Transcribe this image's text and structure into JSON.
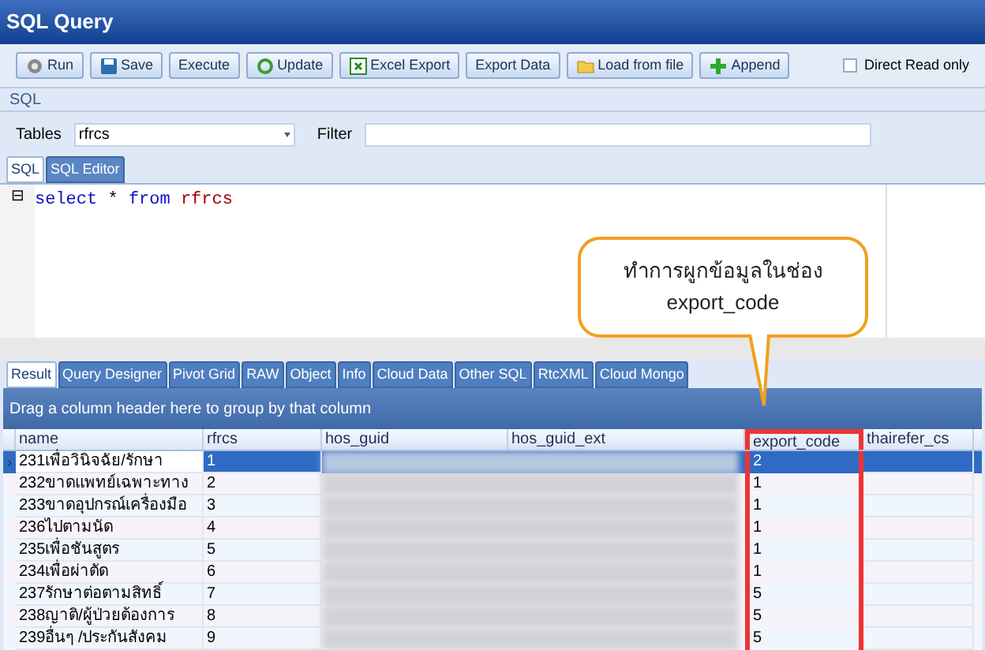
{
  "window": {
    "title": "SQL Query"
  },
  "toolbar": {
    "buttons": [
      "Run",
      "Save",
      "Execute",
      "Update",
      "Excel Export",
      "Export Data",
      "Load from file",
      "Append"
    ],
    "checkbox": {
      "label": "Direct Read only",
      "checked": false
    }
  },
  "section_label": "SQL",
  "tables": {
    "label": "Tables",
    "value": "rfrcs"
  },
  "filter": {
    "label": "Filter"
  },
  "editor_tabs": [
    {
      "label": "SQL",
      "selected": true
    },
    {
      "label": "SQL Editor",
      "selected": false
    }
  ],
  "editor": {
    "fold": "⊟",
    "keyword1": "select",
    "star": "*",
    "keyword2": "from",
    "table": "rfrcs"
  },
  "callout": {
    "line1": "ทำการผูกข้อมูลในช่อง",
    "line2": "export_code"
  },
  "result_tabs": [
    {
      "label": "Result",
      "selected": true
    },
    {
      "label": "Query Designer",
      "selected": false
    },
    {
      "label": "Pivot Grid",
      "selected": false
    },
    {
      "label": "RAW",
      "selected": false
    },
    {
      "label": "Object",
      "selected": false
    },
    {
      "label": "Info",
      "selected": false
    },
    {
      "label": "Cloud Data",
      "selected": false
    },
    {
      "label": "Other SQL",
      "selected": false
    },
    {
      "label": "RtcXML",
      "selected": false
    },
    {
      "label": "Cloud Mongo",
      "selected": false
    }
  ],
  "group_hint": "Drag a column header here to group by that column",
  "table": {
    "columns": [
      "name",
      "rfrcs",
      "hos_guid",
      "hos_guid_ext",
      "export_code",
      "thairefer_cs"
    ],
    "row_marker": "›",
    "rows": [
      {
        "name": "231เพื่อวินิจฉัย/รักษา",
        "rfrcs": "1",
        "export_code": "2",
        "selected": true
      },
      {
        "name": "232ขาดแพทย์เฉพาะทาง",
        "rfrcs": "2",
        "export_code": "1",
        "selected": false
      },
      {
        "name": "233ขาดอุปกรณ์เครื่องมือ",
        "rfrcs": "3",
        "export_code": "1",
        "selected": false
      },
      {
        "name": "236ไปตามนัด",
        "rfrcs": "4",
        "export_code": "1",
        "selected": false
      },
      {
        "name": "235เพื่อชันสูตร",
        "rfrcs": "5",
        "export_code": "1",
        "selected": false
      },
      {
        "name": "234เพื่อผ่าตัด",
        "rfrcs": "6",
        "export_code": "1",
        "selected": false
      },
      {
        "name": "237รักษาต่อตามสิทธิ์",
        "rfrcs": "7",
        "export_code": "5",
        "selected": false
      },
      {
        "name": "238ญาติ/ผู้ป่วยต้องการ",
        "rfrcs": "8",
        "export_code": "5",
        "selected": false
      },
      {
        "name": "239อื่นๆ /ประกันสังคม",
        "rfrcs": "9",
        "export_code": "5",
        "selected": false
      }
    ]
  }
}
